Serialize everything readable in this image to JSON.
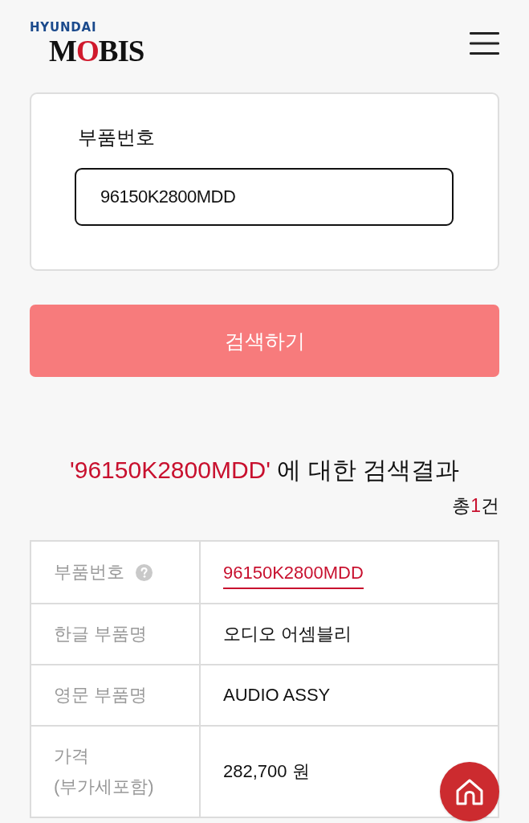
{
  "header": {
    "logo": {
      "brand": "HYUNDAI",
      "name": "MOBIS"
    }
  },
  "search_form": {
    "label": "부품번호",
    "value": "96150K2800MDD"
  },
  "search_button": {
    "label": "검색하기"
  },
  "results": {
    "query": "'96150K2800MDD'",
    "heading": "에 대한 검색결과",
    "count_prefix": "총",
    "count": "1",
    "count_suffix": "건"
  },
  "table": {
    "rows": [
      {
        "label": "부품번호",
        "help": true,
        "value": "96150K2800MDD",
        "link": true
      },
      {
        "label": "한글 부품명",
        "help": false,
        "value": "오디오 어셈블리",
        "link": false
      },
      {
        "label": "영문 부품명",
        "help": false,
        "value": "AUDIO ASSY",
        "link": false
      },
      {
        "label": "가격 (부가세포함)",
        "help": false,
        "value": "282,700 원",
        "link": false
      }
    ]
  }
}
